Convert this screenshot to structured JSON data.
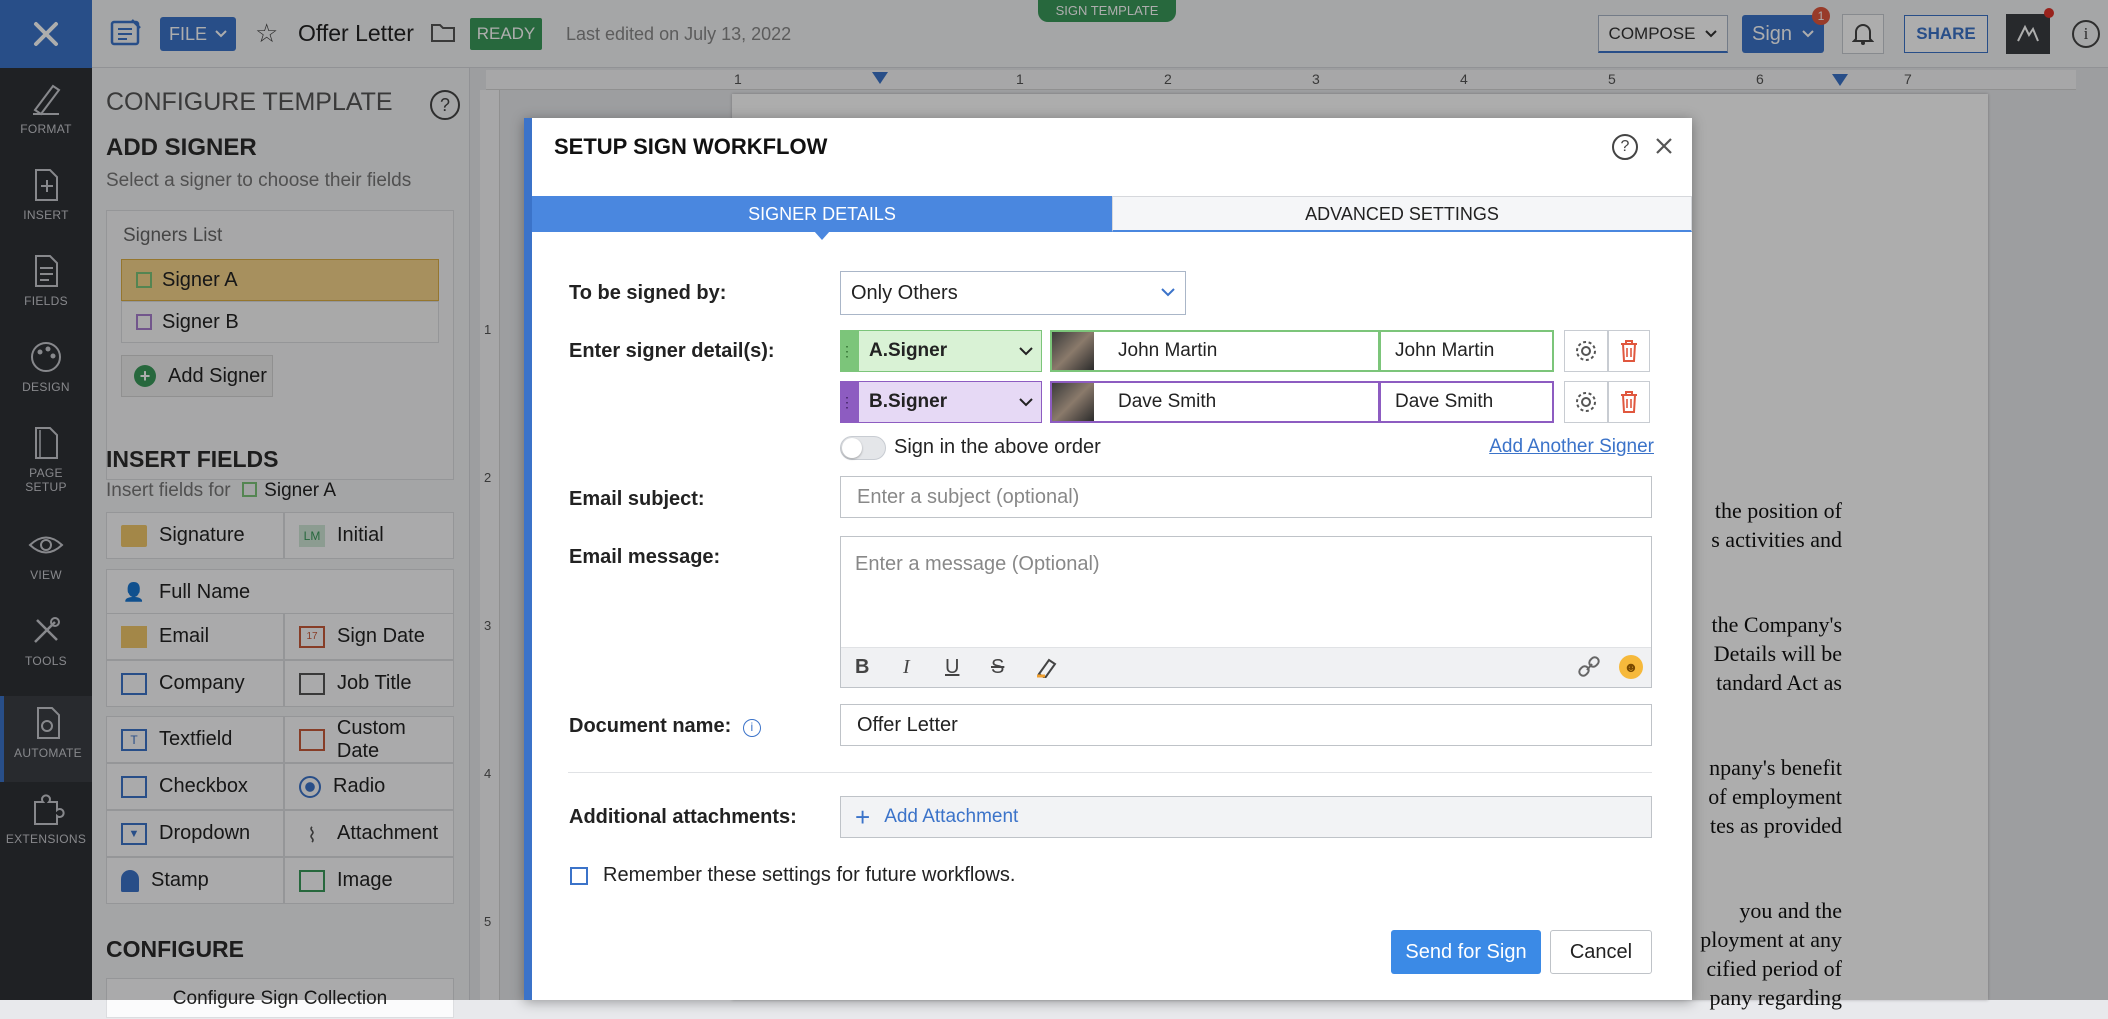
{
  "topbar": {
    "file_label": "FILE",
    "doc_title": "Offer Letter",
    "status_badge": "READY",
    "last_edited": "Last edited on July 13, 2022",
    "template_tab": "SIGN TEMPLATE",
    "compose_label": "COMPOSE",
    "sign_label": "Sign",
    "sign_badge_count": "1",
    "share_label": "SHARE"
  },
  "rail": {
    "items": [
      {
        "label": "FORMAT",
        "icon": "format-icon"
      },
      {
        "label": "INSERT",
        "icon": "insert-icon"
      },
      {
        "label": "FIELDS",
        "icon": "fields-icon"
      },
      {
        "label": "DESIGN",
        "icon": "design-icon"
      },
      {
        "label": "PAGE",
        "label2": "SETUP",
        "icon": "page-setup-icon"
      },
      {
        "label": "VIEW",
        "icon": "view-icon"
      },
      {
        "label": "TOOLS",
        "icon": "tools-icon"
      },
      {
        "label": "AUTOMATE",
        "icon": "automate-icon",
        "active": true
      },
      {
        "label": "EXTENSIONS",
        "icon": "extensions-icon"
      }
    ]
  },
  "panel": {
    "title": "CONFIGURE TEMPLATE",
    "add_signer_heading": "ADD SIGNER",
    "add_signer_sub": "Select a signer to choose their fields",
    "signers_list_label": "Signers List",
    "signers": [
      {
        "name": "Signer A",
        "color": "#7cc57a"
      },
      {
        "name": "Signer B",
        "color": "#a97fcf"
      }
    ],
    "add_signer_button": "Add Signer",
    "insert_fields_heading": "INSERT FIELDS",
    "insert_fields_for": "Insert fields for",
    "insert_fields_signer": "Signer A",
    "fields": {
      "signature": "Signature",
      "initial": "Initial",
      "full_name": "Full Name",
      "email": "Email",
      "sign_date": "Sign Date",
      "company": "Company",
      "job_title": "Job Title",
      "textfield": "Textfield",
      "custom_date": "Custom Date",
      "checkbox": "Checkbox",
      "radio": "Radio",
      "dropdown": "Dropdown",
      "attachment": "Attachment",
      "stamp": "Stamp",
      "image": "Image"
    },
    "configure_heading": "CONFIGURE",
    "configure_sign_collection": "Configure Sign Collection"
  },
  "ruler": {
    "marks": [
      "1",
      "1",
      "2",
      "3",
      "4",
      "5",
      "6",
      "7"
    ],
    "vmarks": [
      "1",
      "2",
      "3",
      "4",
      "5"
    ]
  },
  "document": {
    "lines": [
      "the position of",
      "s activities and",
      "the Company's",
      "Details will be",
      "tandard Act as",
      "npany's benefit",
      "of employment",
      "tes as provided",
      "you and the",
      "ployment at any",
      "cified period of",
      "pany regarding"
    ]
  },
  "dialog": {
    "title": "SETUP SIGN WORKFLOW",
    "tabs": [
      {
        "label": "SIGNER DETAILS",
        "active": true
      },
      {
        "label": "ADVANCED SETTINGS",
        "active": false
      }
    ],
    "signed_by_label": "To be signed by:",
    "signed_by_value": "Only Others",
    "signer_details_label": "Enter signer detail(s):",
    "signer_rows": [
      {
        "role": "A.Signer",
        "name": "John Martin",
        "display": "John Martin",
        "color": "#7cc57a",
        "bg": "#d9f2d5"
      },
      {
        "role": "B.Signer",
        "name": "Dave Smith",
        "display": "Dave Smith",
        "color": "#8d5cc1",
        "bg": "#e6d9f5"
      }
    ],
    "sign_order_label": "Sign in the above order",
    "add_another_signer": "Add Another Signer",
    "email_subject_label": "Email subject:",
    "email_subject_placeholder": "Enter a subject (optional)",
    "email_message_label": "Email message:",
    "email_message_placeholder": "Enter a message (Optional)",
    "doc_name_label": "Document name:",
    "doc_name_value": "Offer Letter",
    "attachments_label": "Additional attachments:",
    "add_attachment": "Add Attachment",
    "remember_label": "Remember these settings for future workflows.",
    "send_button": "Send for Sign",
    "cancel_button": "Cancel"
  },
  "colors": {
    "accent": "#3b73c9",
    "ready": "#3a9a5b",
    "danger": "#e0573e"
  }
}
